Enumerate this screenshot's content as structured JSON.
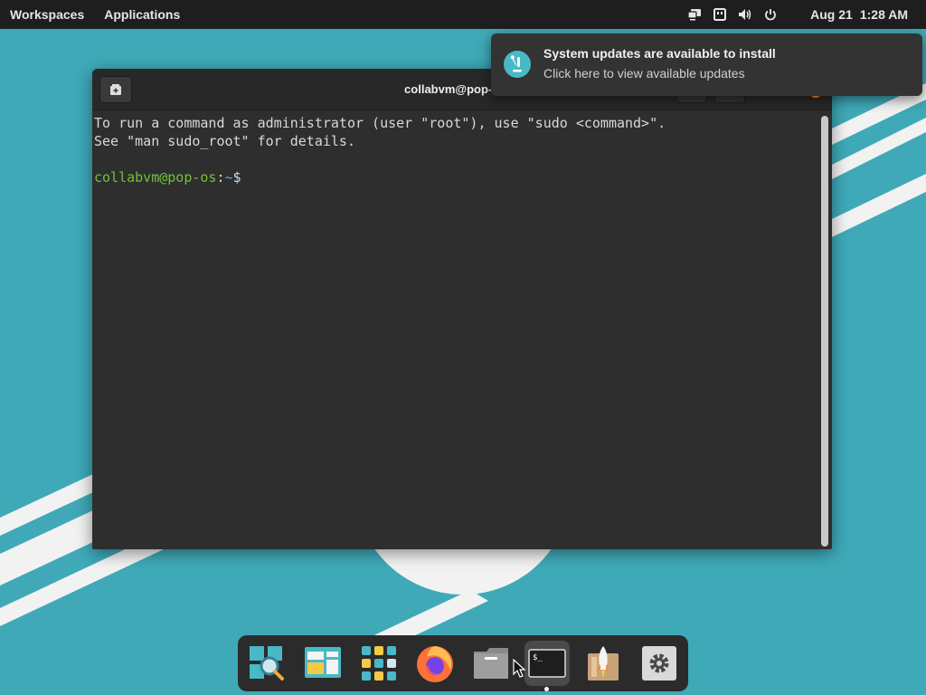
{
  "top_panel": {
    "workspaces": "Workspaces",
    "applications": "Applications",
    "date": "Aug 21",
    "time": "1:28 AM",
    "status_icons": [
      "screen-share-icon",
      "network-wired-icon",
      "volume-icon",
      "power-icon"
    ]
  },
  "notification": {
    "title": "System updates are available to install",
    "body": "Click here to view available updates",
    "icon": "pop-os-logo-icon"
  },
  "terminal": {
    "title": "collabvm@pop-os: ~",
    "lines": [
      "To run a command as administrator (user \"root\"), use \"sudo <command>\".",
      "See \"man sudo_root\" for details."
    ],
    "prompt_user": "collabvm@pop-os",
    "prompt_sep": ":",
    "prompt_path": "~",
    "prompt_symbol": "$"
  },
  "dock": {
    "items": [
      {
        "name": "search-icon"
      },
      {
        "name": "workspaces-icon"
      },
      {
        "name": "app-grid-icon"
      },
      {
        "name": "firefox-icon"
      },
      {
        "name": "files-icon"
      },
      {
        "name": "terminal-icon",
        "active": true,
        "label": "$_"
      },
      {
        "name": "pop-shop-icon"
      },
      {
        "name": "settings-icon"
      }
    ]
  },
  "colors": {
    "desktop": "#3fa9b8",
    "panel": "#1e1e1e",
    "terminal_bg": "#2e2e2e",
    "prompt_user": "#73c138",
    "prompt_path": "#5fa8e8",
    "accent_orange": "#f28c38"
  }
}
